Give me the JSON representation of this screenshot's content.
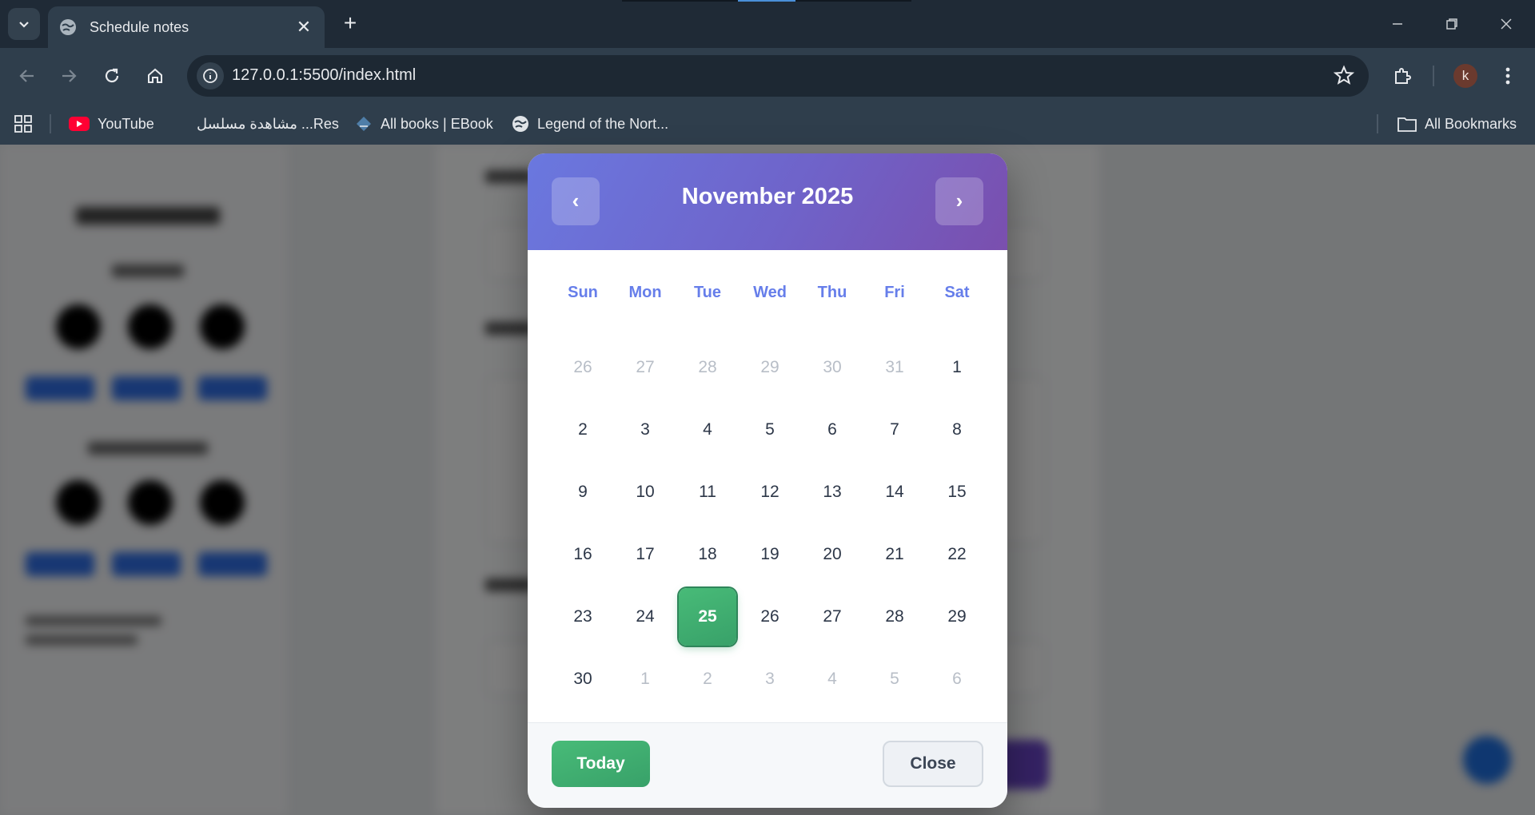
{
  "browser": {
    "tab_title": "Schedule notes",
    "tab_close": "✕",
    "new_tab": "+",
    "url": "127.0.0.1:5500/index.html",
    "profile_initial": "k",
    "bookmarks": [
      {
        "label": "YouTube",
        "icon": "youtube-icon"
      },
      {
        "label": "مشاهدة مسلسل ...Res",
        "icon": "blank-icon"
      },
      {
        "label": "All books | EBook",
        "icon": "ebook-icon"
      },
      {
        "label": "Legend of the Nort...",
        "icon": "globe-icon"
      }
    ],
    "all_bookmarks": "All Bookmarks"
  },
  "calendar": {
    "prev": "‹",
    "next": "›",
    "month_title": "November 2025",
    "weekdays": [
      "Sun",
      "Mon",
      "Tue",
      "Wed",
      "Thu",
      "Fri",
      "Sat"
    ],
    "weeks": [
      [
        {
          "d": "26",
          "other": true
        },
        {
          "d": "27",
          "other": true
        },
        {
          "d": "28",
          "other": true
        },
        {
          "d": "29",
          "other": true
        },
        {
          "d": "30",
          "other": true
        },
        {
          "d": "31",
          "other": true
        },
        {
          "d": "1"
        }
      ],
      [
        {
          "d": "2"
        },
        {
          "d": "3"
        },
        {
          "d": "4"
        },
        {
          "d": "5"
        },
        {
          "d": "6"
        },
        {
          "d": "7"
        },
        {
          "d": "8"
        }
      ],
      [
        {
          "d": "9"
        },
        {
          "d": "10"
        },
        {
          "d": "11"
        },
        {
          "d": "12"
        },
        {
          "d": "13"
        },
        {
          "d": "14"
        },
        {
          "d": "15"
        }
      ],
      [
        {
          "d": "16"
        },
        {
          "d": "17"
        },
        {
          "d": "18"
        },
        {
          "d": "19"
        },
        {
          "d": "20"
        },
        {
          "d": "21"
        },
        {
          "d": "22"
        }
      ],
      [
        {
          "d": "23"
        },
        {
          "d": "24"
        },
        {
          "d": "25",
          "selected": true
        },
        {
          "d": "26"
        },
        {
          "d": "27"
        },
        {
          "d": "28"
        },
        {
          "d": "29"
        }
      ],
      [
        {
          "d": "30"
        },
        {
          "d": "1",
          "other": true
        },
        {
          "d": "2",
          "other": true
        },
        {
          "d": "3",
          "other": true
        },
        {
          "d": "4",
          "other": true
        },
        {
          "d": "5",
          "other": true
        },
        {
          "d": "6",
          "other": true
        }
      ]
    ],
    "today_label": "Today",
    "close_label": "Close"
  },
  "colors": {
    "header_gradient_start": "#6a78df",
    "header_gradient_end": "#7a4fae",
    "selected_green": "#48bb78",
    "weekday_blue": "#667eea"
  }
}
